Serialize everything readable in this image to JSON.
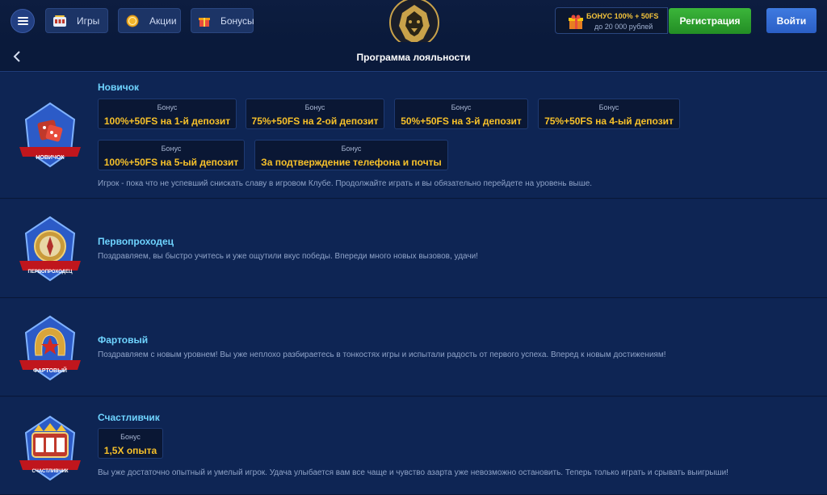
{
  "header": {
    "nav": [
      {
        "label": "Игры",
        "icon": "slot-machine-icon"
      },
      {
        "label": "Акции",
        "icon": "coin-icon"
      },
      {
        "label": "Бонусы",
        "icon": "gift-icon"
      }
    ],
    "bonus_promo": {
      "line1": "БОНУС 100% + 50FS",
      "line2": "до 20 000 рублей"
    },
    "register_label": "Регистрация",
    "login_label": "Войти"
  },
  "page": {
    "title": "Программа лояльности"
  },
  "levels": [
    {
      "name": "Новичок",
      "badge_label": "НОВИЧОК",
      "bonus_label": "Бонус",
      "bonuses": [
        "100%+50FS на 1-й депозит",
        "75%+50FS на 2-ой депозит",
        "50%+50FS на 3-й депозит",
        "75%+50FS на 4-ый депозит",
        "100%+50FS на 5-ый депозит",
        "За подтверждение телефона и почты"
      ],
      "description": "Игрок - пока что не успевший снискать славу в игровом Клубе. Продолжайте играть и вы обязательно перейдете на уровень выше."
    },
    {
      "name": "Первопроходец",
      "badge_label": "ПЕРВОПРОХОДЕЦ",
      "description": "Поздравляем, вы быстро учитесь и уже ощутили вкус победы. Впереди много новых вызовов, удачи!"
    },
    {
      "name": "Фартовый",
      "badge_label": "ФАРТОВЫЙ",
      "description": "Поздравляем с новым уровнем! Вы уже неплохо разбираетесь в тонкостях игры и испытали радость от первого успеха. Вперед к новым достижениям!"
    },
    {
      "name": "Счастливчик",
      "badge_label": "СЧАСТЛИВЧИК",
      "bonus_label": "Бонус",
      "bonuses": [
        "1,5X опыта"
      ],
      "description": "Вы уже достаточно опытный и умелый игрок. Удача улыбается вам все чаще и чувство азарта уже невозможно остановить. Теперь только играть и срывать выигрыши!"
    }
  ],
  "colors": {
    "accent_gold": "#f7c12a",
    "level_name": "#6fd4ff",
    "register_green": "#2fa22f",
    "login_blue": "#3a72d8"
  }
}
